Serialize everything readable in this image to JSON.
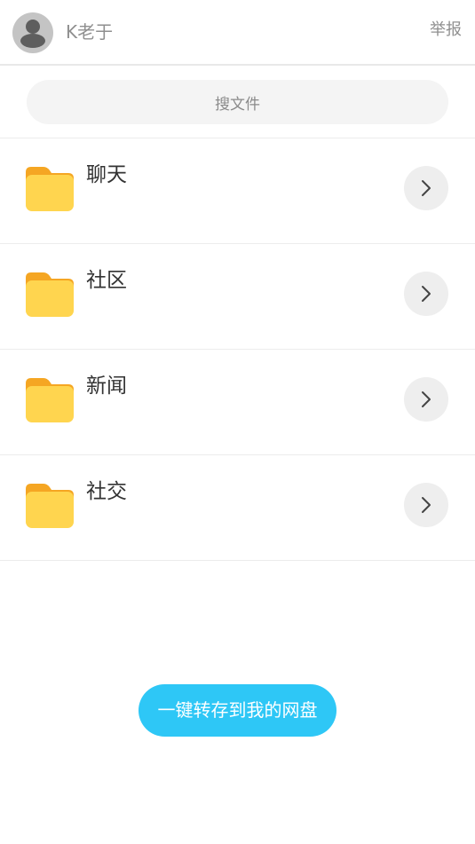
{
  "header": {
    "username": "K老于",
    "report_label": "举报"
  },
  "search": {
    "placeholder": "搜文件"
  },
  "folders": [
    {
      "name": "聊天"
    },
    {
      "name": "社区"
    },
    {
      "name": "新闻"
    },
    {
      "name": "社交"
    }
  ],
  "save_button_label": "一键转存到我的网盘",
  "colors": {
    "accent": "#2ec7f6",
    "folder_front": "#ffd54f",
    "folder_back": "#f5a623",
    "divider": "#ececec"
  },
  "icons": {
    "avatar": "user-avatar-icon",
    "folder": "folder-icon",
    "chevron": "chevron-right-icon"
  }
}
